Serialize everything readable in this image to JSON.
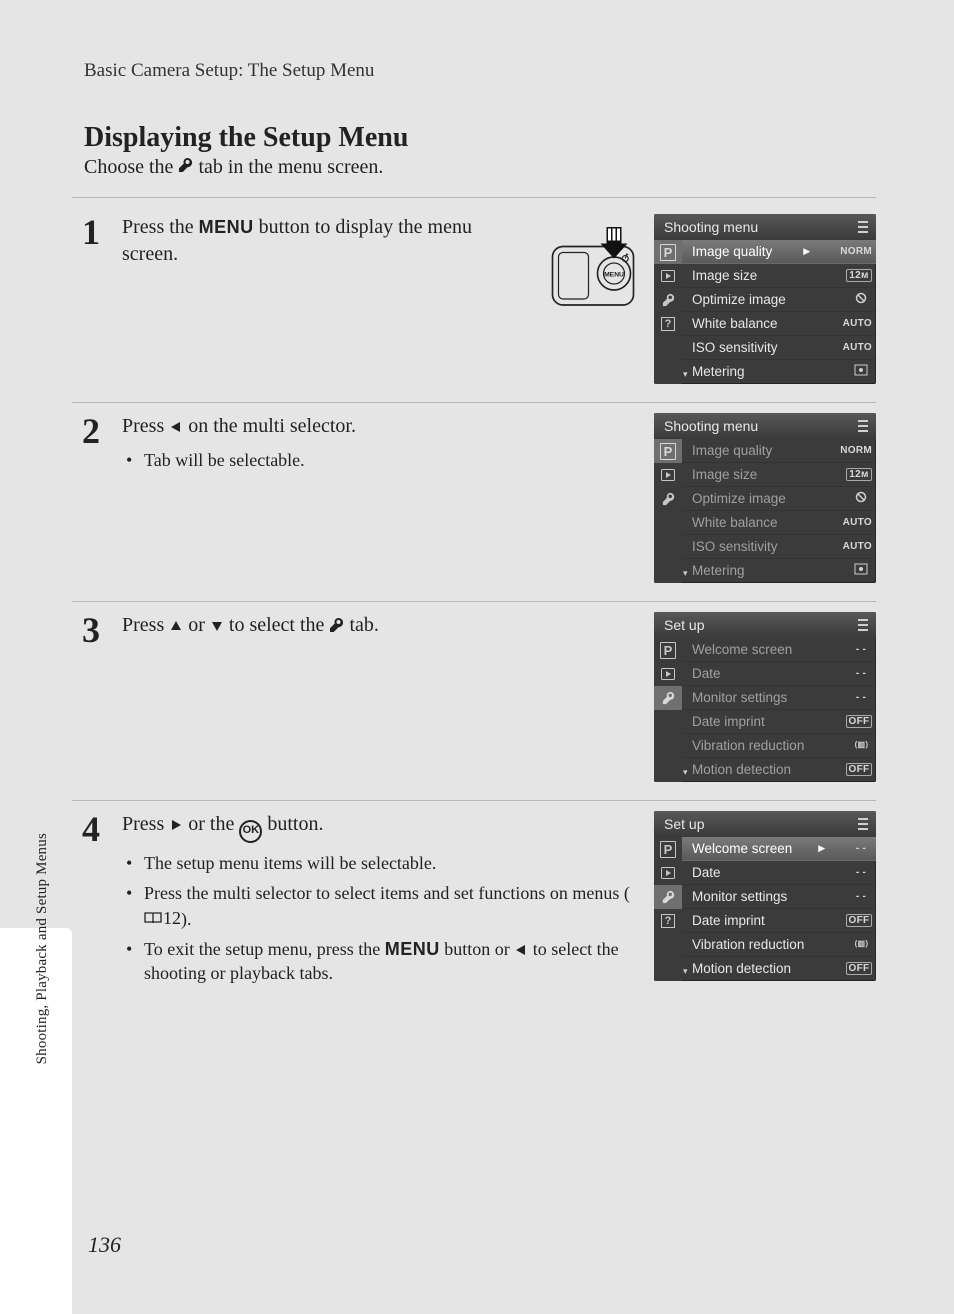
{
  "breadcrumb": "Basic Camera Setup: The Setup Menu",
  "title": "Displaying the Setup Menu",
  "subtitle_pre": "Choose the ",
  "subtitle_post": " tab in the menu screen.",
  "sidebar_label": "Shooting, Playback and Setup Menus",
  "page_number": "136",
  "menu_word": "MENU",
  "ok_label": "OK",
  "book_ref": "12",
  "steps": [
    {
      "num": "1",
      "lead_parts": [
        "Press the ",
        "MENU_WORD",
        " button to display the menu screen."
      ]
    },
    {
      "num": "2",
      "lead_parts": [
        "Press ",
        "LEFT_ARROW",
        " on the multi selector."
      ],
      "bullets": [
        {
          "parts": [
            "Tab will be selectable."
          ]
        }
      ]
    },
    {
      "num": "3",
      "lead_parts": [
        "Press ",
        "UP_ARROW",
        " or ",
        "DOWN_ARROW",
        " to select the ",
        "WRENCH",
        " tab."
      ]
    },
    {
      "num": "4",
      "lead_parts": [
        "Press ",
        "RIGHT_ARROW",
        " or the ",
        "OK_BUTTON",
        " button."
      ],
      "bullets": [
        {
          "parts": [
            "The setup menu items will be selectable."
          ]
        },
        {
          "parts": [
            "Press the multi selector to select items and set functions on menus (",
            "BOOK_REF",
            ")."
          ]
        },
        {
          "parts": [
            "To exit the setup menu, press the ",
            "MENU_WORD",
            " button or ",
            "LEFT_ARROW",
            " to select the shooting or playback tabs."
          ]
        }
      ]
    }
  ],
  "screens": [
    {
      "header": "Shooting menu",
      "dim": false,
      "tabs": [
        "P",
        "PLAY",
        "WRENCH",
        "?"
      ],
      "sel_tab": 0,
      "highlight": 0,
      "rows": [
        {
          "label": "Image quality",
          "value": "NORM",
          "arrow": true
        },
        {
          "label": "Image size",
          "value": "12M"
        },
        {
          "label": "Optimize image",
          "value": "ICON_OPT"
        },
        {
          "label": "White balance",
          "value": "AUTO"
        },
        {
          "label": "ISO sensitivity",
          "value": "AUTO"
        },
        {
          "label": "Metering",
          "value": "ICON_MTR"
        }
      ]
    },
    {
      "header": "Shooting menu",
      "dim": true,
      "tabs": [
        "P",
        "PLAY",
        "WRENCH"
      ],
      "sel_tab": 0,
      "highlight": -1,
      "rows": [
        {
          "label": "Image quality",
          "value": "NORM"
        },
        {
          "label": "Image size",
          "value": "12M"
        },
        {
          "label": "Optimize image",
          "value": "ICON_OPT"
        },
        {
          "label": "White balance",
          "value": "AUTO"
        },
        {
          "label": "ISO sensitivity",
          "value": "AUTO"
        },
        {
          "label": "Metering",
          "value": "ICON_MTR"
        }
      ]
    },
    {
      "header": "Set up",
      "dim": true,
      "tabs": [
        "P",
        "PLAY",
        "WRENCH"
      ],
      "sel_tab": 2,
      "highlight": -1,
      "rows": [
        {
          "label": "Welcome screen",
          "value": "--"
        },
        {
          "label": "Date",
          "value": "--"
        },
        {
          "label": "Monitor settings",
          "value": "--"
        },
        {
          "label": "Date imprint",
          "value": "OFF"
        },
        {
          "label": "Vibration reduction",
          "value": "ICON_VR"
        },
        {
          "label": "Motion detection",
          "value": "OFF"
        }
      ]
    },
    {
      "header": "Set up",
      "dim": false,
      "tabs": [
        "P",
        "PLAY",
        "WRENCH",
        "?"
      ],
      "sel_tab": 2,
      "highlight": 0,
      "rows": [
        {
          "label": "Welcome screen",
          "value": "--",
          "arrow": true
        },
        {
          "label": "Date",
          "value": "--"
        },
        {
          "label": "Monitor settings",
          "value": "--"
        },
        {
          "label": "Date imprint",
          "value": "OFF"
        },
        {
          "label": "Vibration reduction",
          "value": "ICON_VR"
        },
        {
          "label": "Motion detection",
          "value": "OFF"
        }
      ]
    }
  ]
}
